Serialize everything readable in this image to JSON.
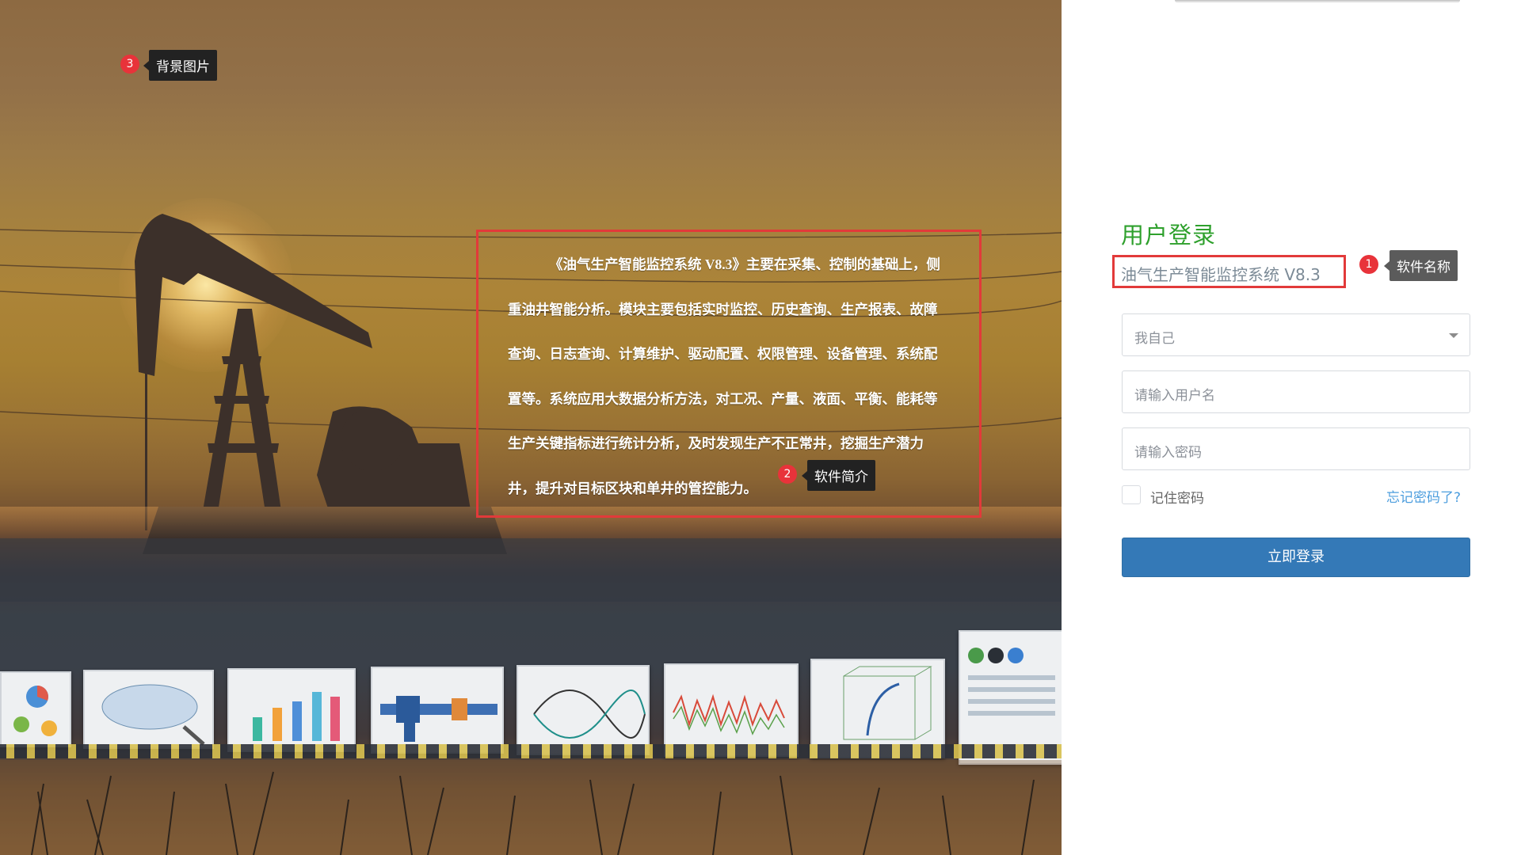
{
  "background": {
    "annotation_number": "3",
    "annotation_label": "背景图片"
  },
  "intro": {
    "annotation_number": "2",
    "annotation_label": "软件简介",
    "text": "《油气生产智能监控系统 V8.3》主要在采集、控制的基础上，侧重油井智能分析。模块主要包括实时监控、历史查询、生产报表、故障查询、日志查询、计算维护、驱动配置、权限管理、设备管理、系统配置等。系统应用大数据分析方法，对工况、产量、液面、平衡、能耗等生产关键指标进行统计分析，及时发现生产不正常井，挖掘生产潜力井，提升对目标区块和单井的管控能力。"
  },
  "login": {
    "title": "用户登录",
    "software_name": "油气生产智能监控系统 V8.3",
    "name_annotation_number": "1",
    "name_annotation_label": "软件名称",
    "role_select_value": "我自己",
    "username_placeholder": "请输入用户名",
    "password_placeholder": "请输入密码",
    "remember_label": "记住密码",
    "forgot_link": "忘记密码了?",
    "submit_label": "立即登录"
  },
  "colors": {
    "title_green": "#2ea02c",
    "button_blue": "#3479b7",
    "link_blue": "#4d9ede",
    "annotation_red": "#e23a3a"
  }
}
